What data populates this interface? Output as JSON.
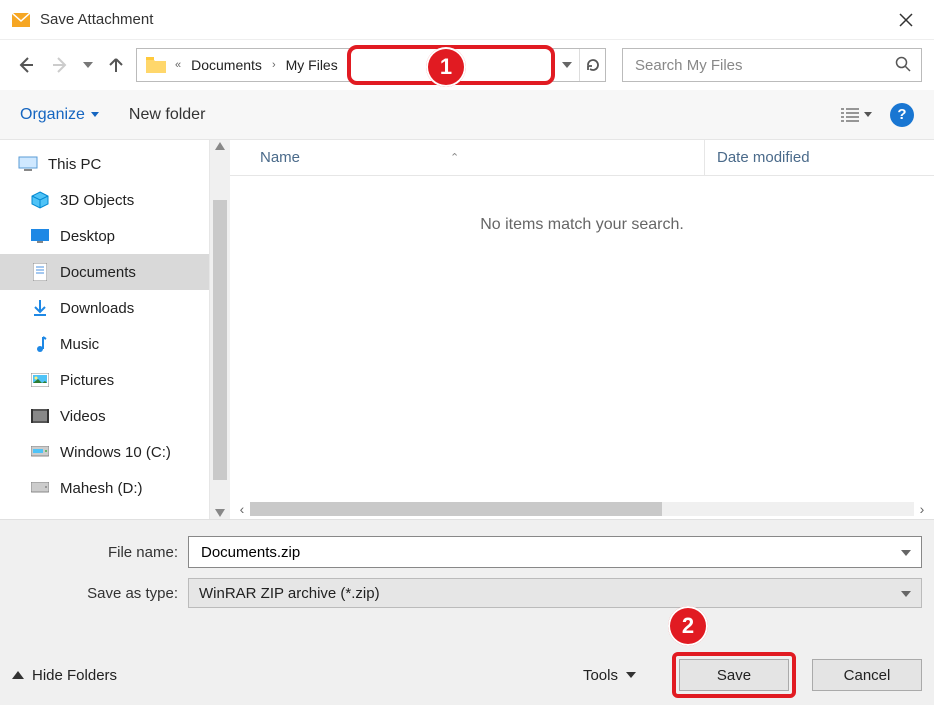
{
  "window": {
    "title": "Save Attachment"
  },
  "breadcrumb": {
    "items": [
      "Documents",
      "My Files"
    ]
  },
  "search": {
    "placeholder": "Search My Files"
  },
  "toolbar": {
    "organize": "Organize",
    "newFolder": "New folder"
  },
  "columns": {
    "name": "Name",
    "dateModified": "Date modified"
  },
  "tree": {
    "root": "This PC",
    "items": [
      {
        "label": "3D Objects"
      },
      {
        "label": "Desktop"
      },
      {
        "label": "Documents",
        "selected": true
      },
      {
        "label": "Downloads"
      },
      {
        "label": "Music"
      },
      {
        "label": "Pictures"
      },
      {
        "label": "Videos"
      },
      {
        "label": "Windows 10 (C:)"
      },
      {
        "label": "Mahesh (D:)"
      }
    ]
  },
  "fileList": {
    "emptyMessage": "No items match your search."
  },
  "form": {
    "fileNameLabel": "File name:",
    "fileNameValue": "Documents.zip",
    "saveTypeLabel": "Save as type:",
    "saveTypeValue": "WinRAR ZIP archive (*.zip)"
  },
  "actions": {
    "hideFolders": "Hide Folders",
    "tools": "Tools",
    "save": "Save",
    "cancel": "Cancel"
  },
  "annotations": {
    "badge1": "1",
    "badge2": "2"
  }
}
